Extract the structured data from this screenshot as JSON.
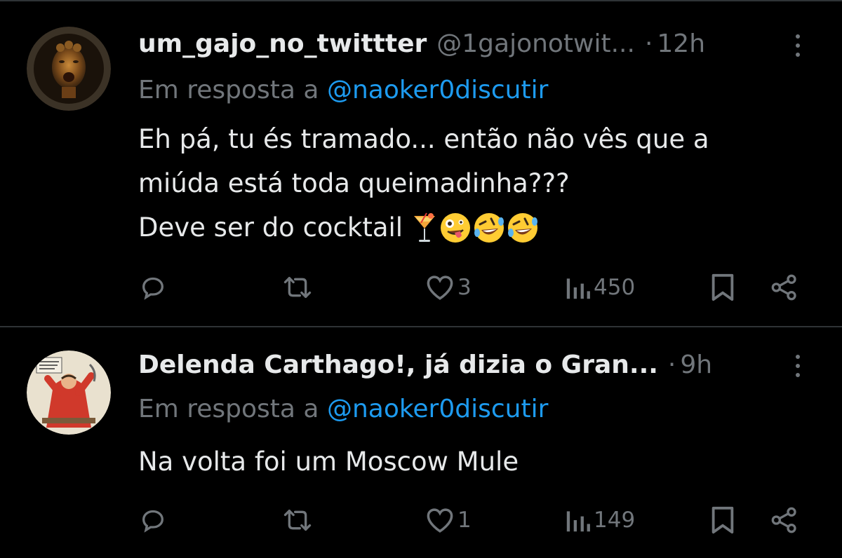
{
  "tweets": [
    {
      "author_name": "um_gajo_no_twittter",
      "handle": "@1gajonotwit...",
      "separator": "·",
      "time": "12h",
      "reply_prefix": "Em resposta a ",
      "reply_to": "@naoker0discutir",
      "lines": [
        "Eh pá, tu és tramado... então não vês que a",
        "miúda está toda queimadinha???",
        "Deve ser do cocktail"
      ],
      "emojis": [
        "cocktail-emoji",
        "zany-face-emoji",
        "rolling-laughing-emoji",
        "rolling-laughing-emoji"
      ],
      "likes": "3",
      "views": "450",
      "avatar_icon": "bronze-face-medallion"
    },
    {
      "author_name": "Delenda Carthago!, já dizia o Gran...",
      "handle": "",
      "separator": "·",
      "time": "9h",
      "reply_prefix": "Em resposta a ",
      "reply_to": "@naoker0discutir",
      "lines": [
        "Na volta foi um Moscow Mule"
      ],
      "likes": "1",
      "views": "149",
      "avatar_icon": "comic-character-avatar"
    }
  ],
  "colors": {
    "background": "#000000",
    "text": "#e7e9ea",
    "muted": "#71767b",
    "link": "#1d9bf0",
    "divider": "#2f3336"
  }
}
